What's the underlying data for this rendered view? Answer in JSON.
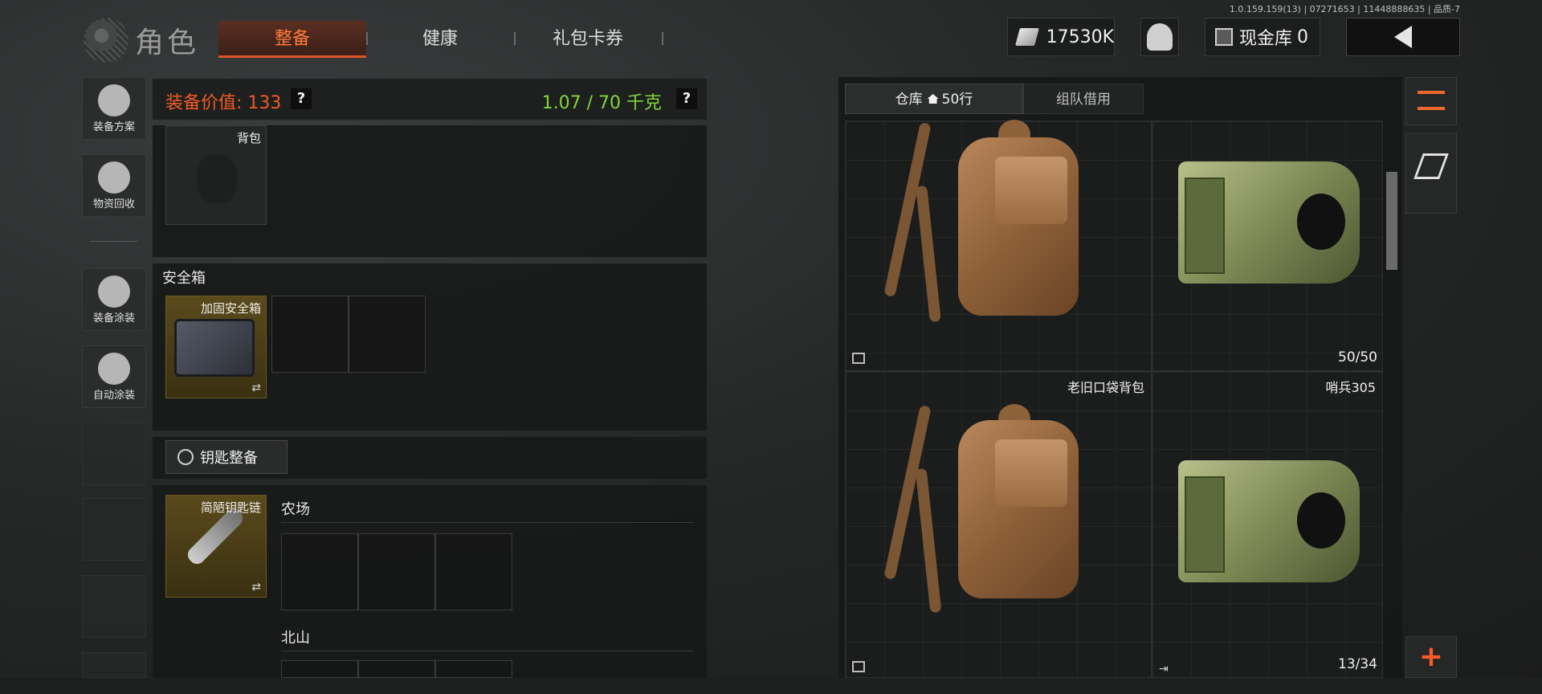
{
  "version": "1.0.159.159(13) | 07271653 | 11448888635 | 品质-7",
  "header": {
    "title": "角色",
    "tabs": [
      "整备",
      "健康",
      "礼包卡券"
    ],
    "active_tab": "整备",
    "money": "17530K",
    "cash_vault_label": "现金库",
    "cash_vault_value": "0"
  },
  "sidebar": {
    "items": [
      {
        "label": "装备方案",
        "icon": "helmet-loadout-icon"
      },
      {
        "label": "物资回收",
        "icon": "recycle-icon"
      },
      {
        "label": "装备涂装",
        "icon": "helmet-paint-icon"
      },
      {
        "label": "自动涂装",
        "icon": "brush-gear-icon"
      }
    ]
  },
  "equipment": {
    "value_label": "装备价值: 133",
    "weight": "1.07 / 70 千克",
    "help": "?",
    "backpack_label": "背包",
    "safebox_title": "安全箱",
    "safebox_item": "加固安全箱",
    "swap_symbol": "⇄",
    "key_button": "钥匙整备",
    "keychain_item": "简陋钥匙链",
    "map_farm": "农场",
    "map_north": "北山"
  },
  "warehouse": {
    "tab_storage": "仓库",
    "tab_rows": "50行",
    "tab_team": "组队借用",
    "items": [
      {
        "name": "",
        "count": ""
      },
      {
        "name": "",
        "count": "50/50"
      },
      {
        "name": "老旧口袋背包",
        "count": ""
      },
      {
        "name": "哨兵305",
        "count": "13/34"
      }
    ]
  },
  "right_tools": {
    "add": "+"
  },
  "colors": {
    "accent": "#f05a24",
    "weight_green": "#7fd63a",
    "gold_slot": "#5a4a1c"
  }
}
